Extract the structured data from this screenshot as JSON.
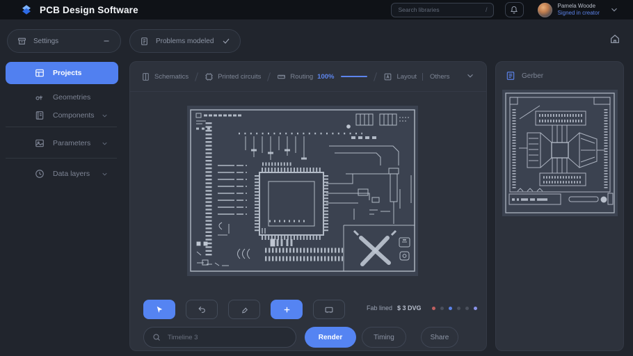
{
  "header": {
    "app_title": "PCB Design Software",
    "search": {
      "placeholder": "Search libraries",
      "shortcut": "/"
    },
    "user": {
      "name": "Pamela Woode",
      "status": "Signed in creator"
    }
  },
  "toolbar": {
    "settings_pill": "Settings",
    "problems_pill": "Problems modeled"
  },
  "sidebar": {
    "items": [
      {
        "label": "Projects",
        "icon": "board-icon",
        "active": true
      },
      {
        "label": "Geometries",
        "icon": "waveform-icon"
      },
      {
        "label": "Components",
        "icon": "book-icon",
        "expandable": true
      },
      {
        "label": "Parameters",
        "icon": "image-icon",
        "expandable": true
      },
      {
        "label": "Data layers",
        "icon": "clock-icon",
        "expandable": true
      }
    ]
  },
  "main": {
    "tabs": [
      {
        "label": "Schematics",
        "icon": "document-icon"
      },
      {
        "label": "Printed circuits",
        "icon": "chip-icon"
      },
      {
        "label": "Routing",
        "pct": "100%",
        "icon": "ruler-icon",
        "active": true
      },
      {
        "label": "Layout",
        "icon": "frame-a-icon"
      },
      {
        "label": "Others"
      }
    ],
    "status": {
      "label": "Fab lined",
      "value": "$ 3 DVG"
    },
    "layer_dots": [
      "#c06060",
      "#4a505c",
      "#5b82e8",
      "#4a505c",
      "#4a505c",
      "#8a93ea"
    ],
    "bottom": {
      "search_placeholder": "Timeline 3",
      "render": "Render",
      "timing": "Timing",
      "share": "Share"
    }
  },
  "right_panel": {
    "title": "Gerber"
  },
  "colors": {
    "accent": "#5584f2",
    "canvas_bg": "#3b4250",
    "panel_bg": "#2d323c"
  }
}
